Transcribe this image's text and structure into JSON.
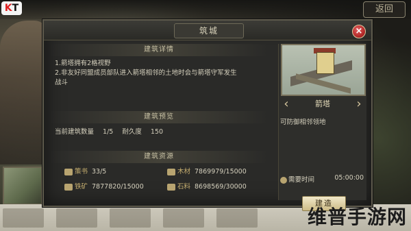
{
  "logo": {
    "text": "KT"
  },
  "top": {
    "back_label": "返回"
  },
  "dialog": {
    "title": "筑城",
    "close": "×",
    "detail": {
      "heading": "建筑详情",
      "lines": [
        "1.箭塔拥有2格视野",
        "2.非友好同盟成员部队进入箭塔相邻的土地时会与箭塔守军发生",
        "战斗"
      ]
    },
    "preview": {
      "heading": "建筑预览",
      "count_label": "当前建筑数量",
      "count_value": "1/5",
      "durability_label": "耐久度",
      "durability_value": "150"
    },
    "resources": {
      "heading": "建筑资源",
      "items": [
        {
          "name": "策书",
          "value": "33/5"
        },
        {
          "name": "木材",
          "value": "7869979/15000"
        },
        {
          "name": "铁矿",
          "value": "7877820/15000"
        },
        {
          "name": "石料",
          "value": "8698569/30000"
        }
      ]
    }
  },
  "building": {
    "name": "箭塔",
    "description": "可防御相邻领地",
    "time_label": "需要时间",
    "time_value": "05:00:00",
    "build_button": "建造"
  },
  "watermark": "维普手游网"
}
